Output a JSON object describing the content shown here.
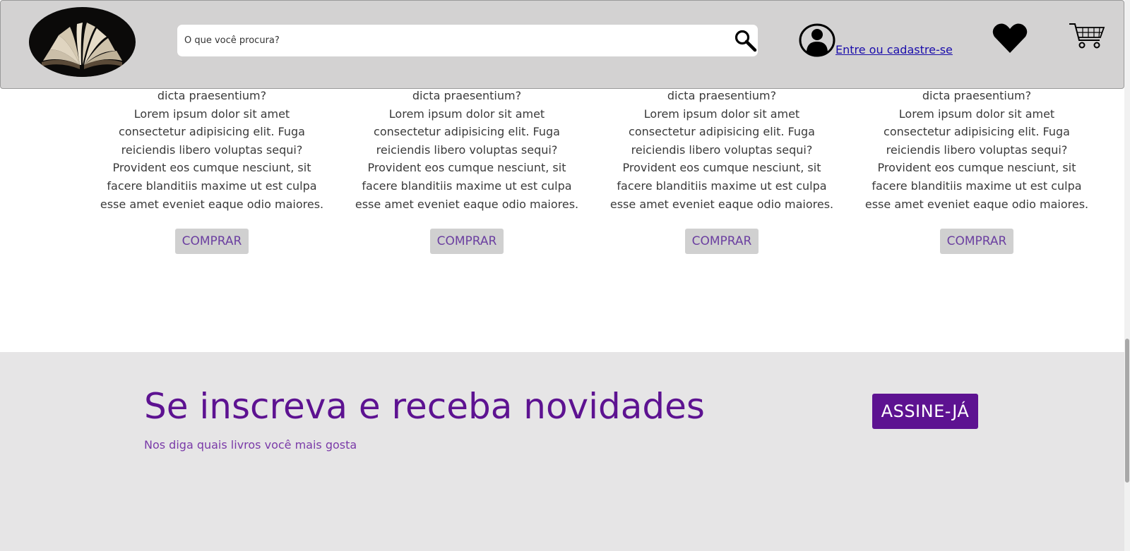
{
  "header": {
    "logo_icon": "open-book-logo",
    "search": {
      "placeholder": "O que você procura?",
      "value": "",
      "icon": "search-icon"
    },
    "user_icon": "user-icon",
    "login_label": "Entre ou cadastre-se",
    "favorites_icon": "heart-icon",
    "cart_icon": "cart-icon"
  },
  "products": [
    {
      "lines": [
        "dicta praesentium?",
        "Lorem ipsum dolor sit amet",
        "consectetur adipisicing elit. Fuga",
        "reiciendis libero voluptas sequi?",
        "Provident eos cumque nesciunt, sit",
        "facere blanditiis maxime ut est culpa",
        "esse amet eveniet eaque odio maiores."
      ],
      "button_label": "COMPRAR"
    },
    {
      "lines": [
        "dicta praesentium?",
        "Lorem ipsum dolor sit amet",
        "consectetur adipisicing elit. Fuga",
        "reiciendis libero voluptas sequi?",
        "Provident eos cumque nesciunt, sit",
        "facere blanditiis maxime ut est culpa",
        "esse amet eveniet eaque odio maiores."
      ],
      "button_label": "COMPRAR"
    },
    {
      "lines": [
        "dicta praesentium?",
        "Lorem ipsum dolor sit amet",
        "consectetur adipisicing elit. Fuga",
        "reiciendis libero voluptas sequi?",
        "Provident eos cumque nesciunt, sit",
        "facere blanditiis maxime ut est culpa",
        "esse amet eveniet eaque odio maiores."
      ],
      "button_label": "COMPRAR"
    },
    {
      "lines": [
        "dicta praesentium?",
        "Lorem ipsum dolor sit amet",
        "consectetur adipisicing elit. Fuga",
        "reiciendis libero voluptas sequi?",
        "Provident eos cumque nesciunt, sit",
        "facere blanditiis maxime ut est culpa",
        "esse amet eveniet eaque odio maiores."
      ],
      "button_label": "COMPRAR"
    }
  ],
  "newsletter": {
    "title": "Se inscreva e receba novidades",
    "subtitle": "Nos diga quais livros você mais gosta",
    "button_label": "ASSINE-JÁ"
  },
  "colors": {
    "header_bg": "#d3d2d2",
    "accent_purple": "#5d1291",
    "newsletter_bg": "#e6e5e6",
    "link": "#1a0dab"
  }
}
